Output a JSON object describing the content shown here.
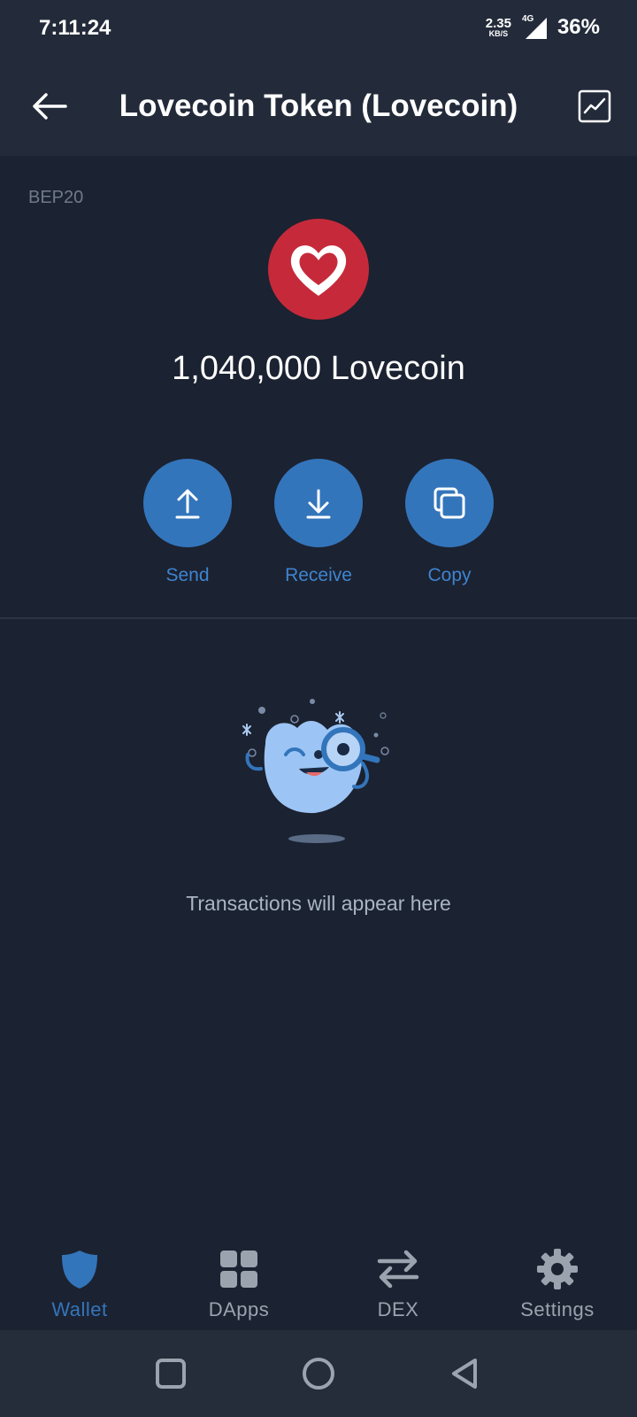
{
  "status_bar": {
    "time": "7:11:24",
    "net_speed_value": "2.35",
    "net_speed_unit": "KB/S",
    "network_type": "4G",
    "battery": "36%"
  },
  "app_bar": {
    "title": "Lovecoin Token (Lovecoin)",
    "back_icon": "arrow-left-icon",
    "chart_icon": "chart-line-icon"
  },
  "token": {
    "network": "BEP20",
    "logo_icon": "heart-icon",
    "balance": "1,040,000 Lovecoin"
  },
  "actions": [
    {
      "label": "Send",
      "icon": "arrow-up-icon"
    },
    {
      "label": "Receive",
      "icon": "arrow-down-icon"
    },
    {
      "label": "Copy",
      "icon": "copy-icon"
    }
  ],
  "empty_state": {
    "message": "Transactions will appear here",
    "illustration": "mascot-magnifier-icon"
  },
  "bottom_nav": {
    "items": [
      {
        "label": "Wallet",
        "icon": "shield-icon",
        "active": true
      },
      {
        "label": "DApps",
        "icon": "grid-icon",
        "active": false
      },
      {
        "label": "DEX",
        "icon": "swap-icon",
        "active": false
      },
      {
        "label": "Settings",
        "icon": "gear-icon",
        "active": false
      }
    ]
  },
  "colors": {
    "background": "#1b2231",
    "app_bar": "#232b3a",
    "accent": "#3375bb",
    "logo": "#c62a3a"
  }
}
